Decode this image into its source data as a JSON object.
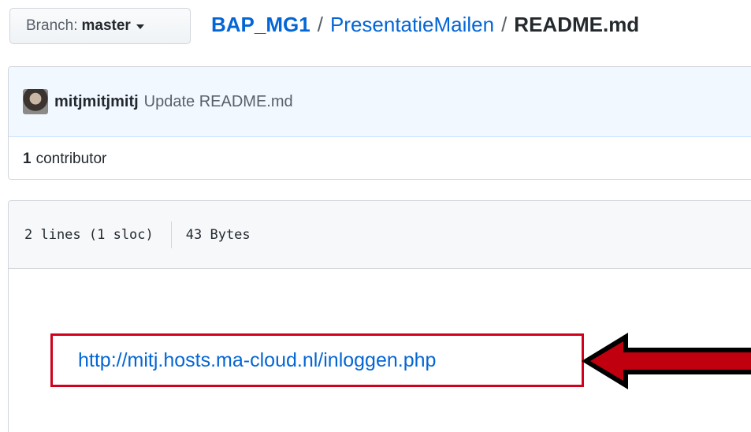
{
  "branch": {
    "prefix": "Branch:",
    "name": "master"
  },
  "breadcrumb": {
    "repo": "BAP_MG1",
    "separator": "/",
    "folder": "PresentatieMailen",
    "file": "README.md"
  },
  "commit": {
    "author": "mitjmitjmitj",
    "message": "Update README.md"
  },
  "contributors": {
    "count": "1",
    "label": "contributor"
  },
  "file_info": {
    "lines": "2 lines (1 sloc)",
    "size": "43 Bytes"
  },
  "readme": {
    "link": "http://mitj.hosts.ma-cloud.nl/inloggen.php"
  },
  "colors": {
    "link": "#0366d6",
    "annotation_red": "#d0021b",
    "commit_bg": "#f1f8ff",
    "file_header_bg": "#f6f8fa"
  },
  "icons": {
    "branch_caret": "chevron-down-icon",
    "annotation": "left-arrow-icon"
  }
}
